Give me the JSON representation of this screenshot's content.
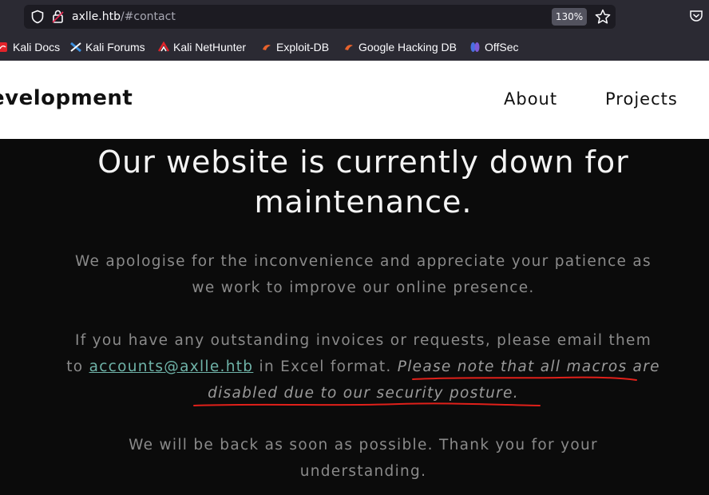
{
  "browser": {
    "url_host": "axlle.htb",
    "url_path": "/#contact",
    "zoom": "130%",
    "bookmarks": [
      {
        "label": "Kali Docs",
        "icon": "kali-docs-icon"
      },
      {
        "label": "Kali Forums",
        "icon": "kali-forums-icon"
      },
      {
        "label": "Kali NetHunter",
        "icon": "kali-nethunter-icon"
      },
      {
        "label": "Exploit-DB",
        "icon": "exploit-db-icon"
      },
      {
        "label": "Google Hacking DB",
        "icon": "ghdb-icon"
      },
      {
        "label": "OffSec",
        "icon": "offsec-icon"
      }
    ]
  },
  "site": {
    "brand": "evelopment",
    "nav": {
      "about": "About",
      "projects": "Projects"
    }
  },
  "main": {
    "headline": "Our website is currently down for maintenance.",
    "para1": "We apologise for the inconvenience and appreciate your patience as we work to improve our online presence.",
    "para2_prefix": "If you have any outstanding invoices or requests, please email them to ",
    "email": "accounts@axlle.htb",
    "para2_mid": " in Excel format. ",
    "para2_notice": "Please note that all macros are disabled due to our security posture.",
    "para3": "We will be back as soon as possible. Thank you for your understanding."
  },
  "colors": {
    "chrome": "#2b2a33",
    "page_bg": "#0b0b0b",
    "link": "#6fb3a8",
    "annotation": "#e0201a"
  }
}
